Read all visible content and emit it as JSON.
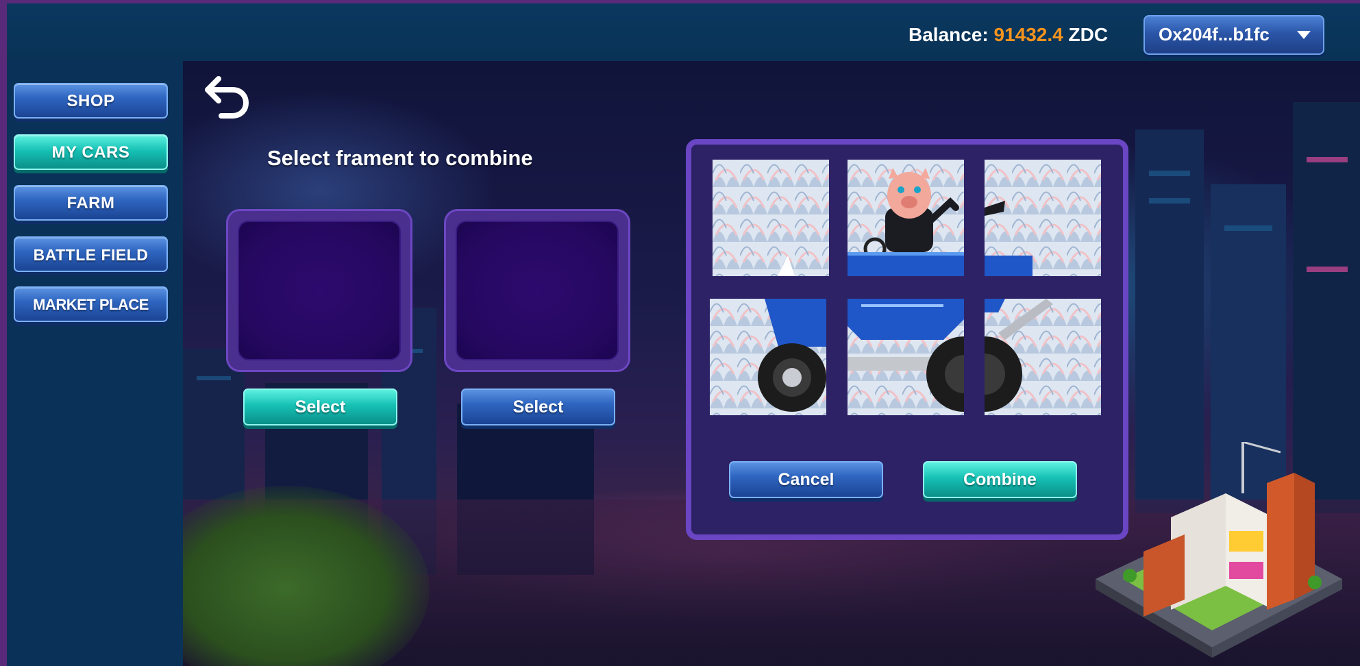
{
  "header": {
    "balance_label": "Balance:",
    "balance_amount": "91432.4",
    "balance_unit": "ZDC",
    "wallet_address": "Ox204f...b1fc"
  },
  "sidebar": {
    "items": [
      {
        "label": "SHOP"
      },
      {
        "label": "MY CARS"
      },
      {
        "label": "FARM"
      },
      {
        "label": "BATTLE FIELD"
      },
      {
        "label": "MARKET PLACE"
      }
    ]
  },
  "main": {
    "title": "Select frament to combine",
    "select_left_label": "Select",
    "select_right_label": "Select"
  },
  "panel": {
    "cancel_label": "Cancel",
    "combine_label": "Combine"
  },
  "icons": {
    "back": "undo-arrow-icon",
    "wallet_caret": "chevron-down-icon"
  },
  "colors": {
    "accent_orange": "#f7941d",
    "teal_button": "#16c1b4",
    "blue_button": "#2f66c1",
    "panel_border": "#6a46c4"
  }
}
